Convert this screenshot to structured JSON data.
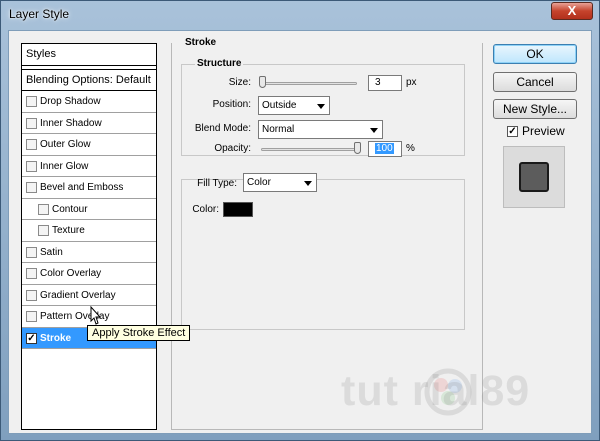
{
  "window": {
    "title": "Layer Style",
    "close_glyph": "X"
  },
  "styles_list": {
    "header": "Styles",
    "blending": "Blending Options: Default",
    "items": [
      {
        "label": "Drop Shadow",
        "checked": false,
        "sub": false
      },
      {
        "label": "Inner Shadow",
        "checked": false,
        "sub": false
      },
      {
        "label": "Outer Glow",
        "checked": false,
        "sub": false
      },
      {
        "label": "Inner Glow",
        "checked": false,
        "sub": false
      },
      {
        "label": "Bevel and Emboss",
        "checked": false,
        "sub": false
      },
      {
        "label": "Contour",
        "checked": false,
        "sub": true
      },
      {
        "label": "Texture",
        "checked": false,
        "sub": true
      },
      {
        "label": "Satin",
        "checked": false,
        "sub": false
      },
      {
        "label": "Color Overlay",
        "checked": false,
        "sub": false
      },
      {
        "label": "Gradient Overlay",
        "checked": false,
        "sub": false
      },
      {
        "label": "Pattern Overlay",
        "checked": false,
        "sub": false
      },
      {
        "label": "Stroke",
        "checked": true,
        "sub": false,
        "selected": true
      }
    ],
    "check_glyph": "✓"
  },
  "stroke": {
    "title": "Stroke",
    "structure": {
      "title": "Structure",
      "size_label": "Size:",
      "size_value": "3",
      "size_unit": "px",
      "size_slider_fraction": 0.01,
      "position_label": "Position:",
      "position_value": "Outside",
      "blend_label": "Blend Mode:",
      "blend_value": "Normal",
      "opacity_label": "Opacity:",
      "opacity_value": "100",
      "opacity_unit": "%",
      "opacity_slider_fraction": 1.0
    },
    "fill": {
      "type_label": "Fill Type:",
      "type_value": "Color",
      "color_label": "Color:",
      "color_hex": "#000000"
    }
  },
  "buttons": {
    "ok": "OK",
    "cancel": "Cancel",
    "new_style": "New Style..."
  },
  "preview": {
    "label": "Preview",
    "checked": true,
    "check_glyph": "✓"
  },
  "tooltip": "Apply Stroke Effect",
  "watermark": "tut  rial89",
  "colors": {
    "selection": "#3399ff",
    "dialog_bg": "#f0f0f0",
    "close_button": "#c5432c"
  }
}
